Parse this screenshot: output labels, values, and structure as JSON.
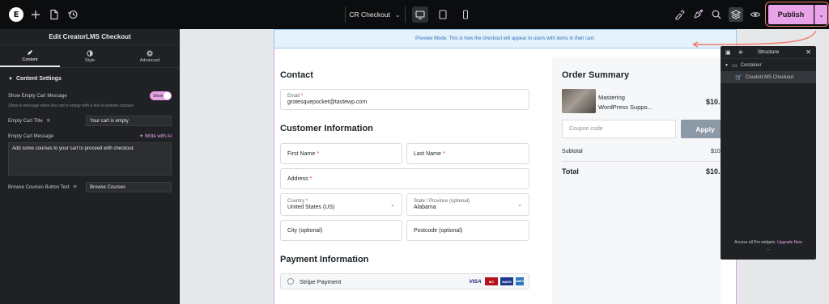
{
  "topbar": {
    "logo": "E",
    "page_name": "CR Checkout",
    "publish_label": "Publish"
  },
  "left_panel": {
    "title": "Edit CreatorLMS Checkout",
    "tabs": [
      {
        "label": "Content",
        "icon": "pencil-icon"
      },
      {
        "label": "Style",
        "icon": "half-circle-icon"
      },
      {
        "label": "Advanced",
        "icon": "gear-icon"
      }
    ],
    "section_title": "Content Settings",
    "show_empty_label": "Show Empty Cart Message",
    "toggle_label": "Show",
    "help_text": "Show a message when the cart is empty with a link to browse courses",
    "empty_title_label": "Empty Cart Title",
    "empty_title_value": "Your cart is empty",
    "empty_message_label": "Empty Cart Message",
    "write_ai_label": "Write with AI",
    "empty_message_value": "Add some courses to your cart to proceed with checkout.",
    "browse_btn_label": "Browse Courses Button Text",
    "browse_btn_value": "Browse Courses"
  },
  "preview": {
    "banner": "Preview Mode: This is how the checkout will appear to users with items in their cart.",
    "contact_heading": "Contact",
    "email_label": "Email",
    "email_value": "grotesquepocket@tastewp.com",
    "customer_heading": "Customer Information",
    "first_name": "First Name",
    "last_name": "Last Name",
    "address": "Address",
    "country_label": "Country",
    "country_value": "United States (US)",
    "state_label": "State / Province (optional)",
    "state_value": "Alabama",
    "city": "City (optional)",
    "postcode": "Postcode (optional)",
    "payment_heading": "Payment Information",
    "payment_method": "Stripe Payment",
    "card_brands": [
      "VISA",
      "MC",
      "MAES",
      "AMEX"
    ],
    "asterisk": "*"
  },
  "order_summary": {
    "heading": "Order Summary",
    "item_title_line1": "Mastering",
    "item_title_line2": "WordPress Suppo...",
    "item_price": "$10.",
    "coupon_placeholder": "Coupon code",
    "apply_label": "Apply",
    "subtotal_label": "Subtotal",
    "subtotal_value": "$10",
    "total_label": "Total",
    "total_value": "$10."
  },
  "structure_panel": {
    "title": "Structure",
    "container_label": "Container",
    "widget_label": "CreatorLMS Checkout",
    "footer_text": "Access all Pro widgets.",
    "upgrade_label": "Upgrade Now",
    "dots": "..."
  },
  "colors": {
    "accent": "#e9a3e8",
    "panel_bg": "#1f2124",
    "annotation": "#f07c6c",
    "banner_text": "#2c6fbd"
  }
}
